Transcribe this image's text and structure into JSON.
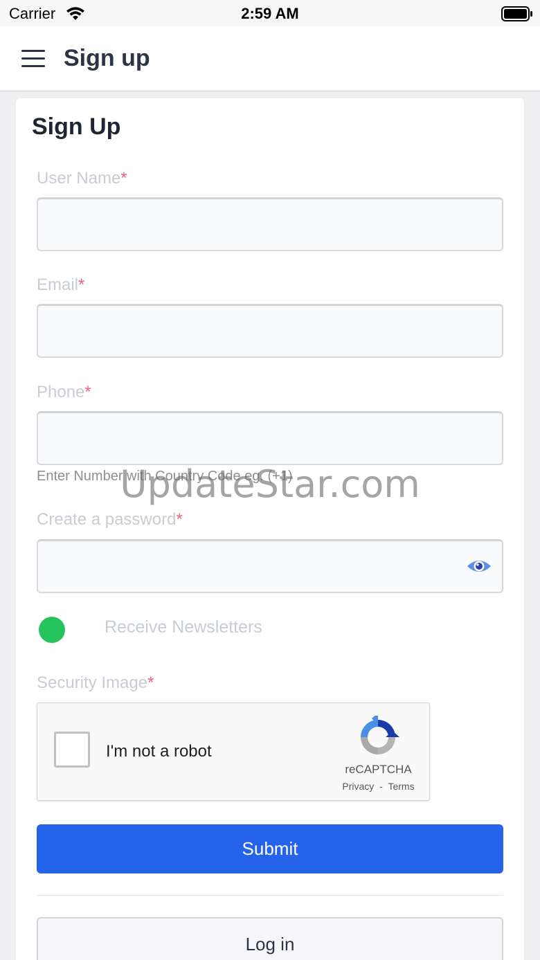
{
  "status_bar": {
    "carrier": "Carrier",
    "time": "2:59 AM",
    "wifi_icon": "wifi-icon",
    "battery_icon": "battery-icon"
  },
  "header": {
    "menu_icon": "hamburger-menu-icon",
    "title": "Sign up"
  },
  "form": {
    "title": "Sign Up",
    "fields": {
      "username": {
        "label": "User Name",
        "required_mark": "*",
        "value": ""
      },
      "email": {
        "label": "Email",
        "required_mark": "*",
        "value": ""
      },
      "phone": {
        "label": "Phone",
        "required_mark": "*",
        "value": "",
        "help": "Enter Number with Country Code eg. (+1)"
      },
      "password": {
        "label": "Create a password",
        "required_mark": "*",
        "value": "",
        "toggle_icon": "eye-icon"
      }
    },
    "newsletter": {
      "label": "Receive Newsletters",
      "state": "on"
    },
    "security": {
      "label": "Security Image",
      "required_mark": "*"
    },
    "recaptcha": {
      "checkbox_label": "I'm not a robot",
      "brand": "reCAPTCHA",
      "privacy": "Privacy",
      "separator": "-",
      "terms": "Terms"
    },
    "submit_label": "Submit",
    "login_label": "Log in"
  },
  "watermark": "UpdateStar.com",
  "colors": {
    "primary": "#2563eb",
    "toggle_on": "#25c35b",
    "required": "#f06080"
  }
}
